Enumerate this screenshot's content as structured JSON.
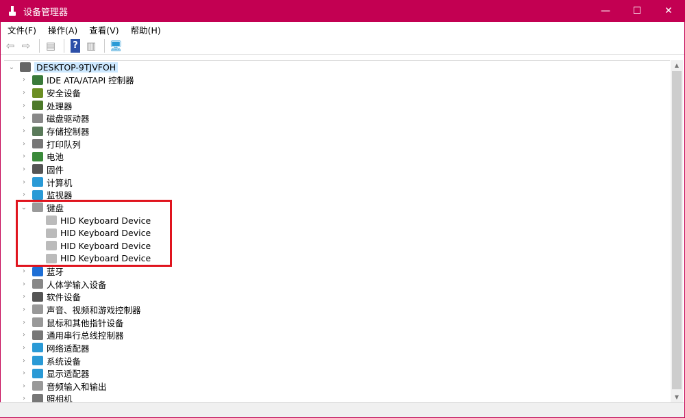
{
  "window": {
    "title": "设备管理器",
    "minimize": "—",
    "maximize": "☐",
    "close": "✕",
    "accent": "#c30052"
  },
  "menu": [
    "文件(F)",
    "操作(A)",
    "查看(V)",
    "帮助(H)"
  ],
  "toolbar": [
    {
      "icon": "back-arrow-icon",
      "g": "⇦"
    },
    {
      "icon": "forward-arrow-icon",
      "g": "⇨"
    },
    {
      "sep": true
    },
    {
      "icon": "properties-icon",
      "g": "▤"
    },
    {
      "sep": true
    },
    {
      "icon": "help-icon",
      "g": "?"
    },
    {
      "icon": "update-driver-icon",
      "g": "▥"
    },
    {
      "sep": true
    },
    {
      "icon": "scan-hardware-icon",
      "g": "🖥"
    }
  ],
  "tree": {
    "root": "DESKTOP-9TJVFOH",
    "items": [
      {
        "label": "IDE ATA/ATAPI 控制器",
        "icon": "ide-controller-icon",
        "color": "#3a7a3a"
      },
      {
        "label": "安全设备",
        "icon": "security-device-icon",
        "color": "#6b8e23"
      },
      {
        "label": "处理器",
        "icon": "processor-icon",
        "color": "#4d7a2a"
      },
      {
        "label": "磁盘驱动器",
        "icon": "disk-drive-icon",
        "color": "#888888"
      },
      {
        "label": "存储控制器",
        "icon": "storage-controller-icon",
        "color": "#5a7a5a"
      },
      {
        "label": "打印队列",
        "icon": "printer-icon",
        "color": "#777777"
      },
      {
        "label": "电池",
        "icon": "battery-icon",
        "color": "#3a8a3a"
      },
      {
        "label": "固件",
        "icon": "firmware-icon",
        "color": "#555555"
      },
      {
        "label": "计算机",
        "icon": "computer-icon",
        "color": "#2a9ad6"
      },
      {
        "label": "监视器",
        "icon": "monitor-icon",
        "color": "#2a9ad6"
      },
      {
        "label": "键盘",
        "icon": "keyboard-icon",
        "color": "#9a9a9a",
        "expanded": true,
        "children": [
          "HID Keyboard Device",
          "HID Keyboard Device",
          "HID Keyboard Device",
          "HID Keyboard Device"
        ]
      },
      {
        "label": "蓝牙",
        "icon": "bluetooth-icon",
        "color": "#1e6fd6"
      },
      {
        "label": "人体学输入设备",
        "icon": "hid-icon",
        "color": "#888888"
      },
      {
        "label": "软件设备",
        "icon": "software-device-icon",
        "color": "#555555"
      },
      {
        "label": "声音、视频和游戏控制器",
        "icon": "sound-icon",
        "color": "#999999"
      },
      {
        "label": "鼠标和其他指针设备",
        "icon": "mouse-icon",
        "color": "#999999"
      },
      {
        "label": "通用串行总线控制器",
        "icon": "usb-icon",
        "color": "#777777"
      },
      {
        "label": "网络适配器",
        "icon": "network-adapter-icon",
        "color": "#2a9ad6"
      },
      {
        "label": "系统设备",
        "icon": "system-device-icon",
        "color": "#2a9ad6"
      },
      {
        "label": "显示适配器",
        "icon": "display-adapter-icon",
        "color": "#2a9ad6"
      },
      {
        "label": "音频输入和输出",
        "icon": "audio-io-icon",
        "color": "#999999"
      },
      {
        "label": "照相机",
        "icon": "camera-icon",
        "color": "#777777"
      }
    ]
  }
}
